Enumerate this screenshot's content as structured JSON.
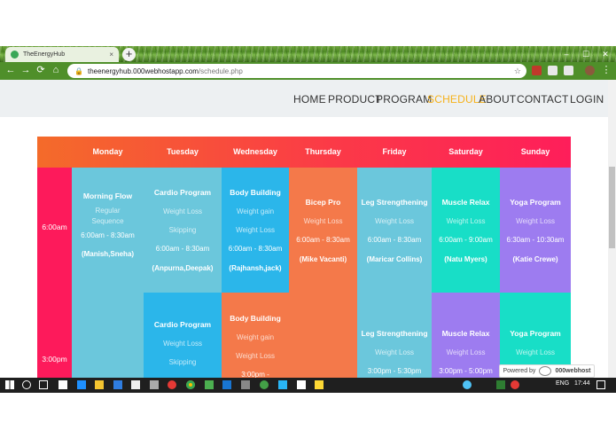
{
  "browser": {
    "tab_title": "TheEnergyHub",
    "tab_close": "×",
    "new_tab": "+",
    "url_host": "theenergyhub.000webhostapp.com",
    "url_path": "/schedule.php",
    "minimize": "–",
    "maximize": "☐",
    "close": "✕",
    "back": "←",
    "forward": "→",
    "reload": "⟳",
    "home": "⌂",
    "lock": "🔒",
    "star": "☆",
    "menu": "⋮"
  },
  "nav": {
    "home": "HOME",
    "product": "PRODUCT",
    "program": "PROGRAM",
    "schedule": "SCHEDULE",
    "about": "ABOUT",
    "contact": "CONTACT",
    "login": "LOGIN",
    "active_color": "#f6b21b"
  },
  "schedule": {
    "days": [
      "Monday",
      "Tuesday",
      "Wednesday",
      "Thursday",
      "Friday",
      "Saturday",
      "Sunday"
    ],
    "times": [
      "6:00am",
      "3:00pm"
    ],
    "morning": {
      "monday": {
        "title": "Morning Flow",
        "line1": "Regular",
        "line2": "Sequence",
        "time": "6:00am - 8:30am",
        "trainer": "(Manish,Sneha)"
      },
      "tuesday": {
        "title": "Cardio Program",
        "line1": "Weight Loss",
        "line2": "Skipping",
        "time": "6:00am - 8:30am",
        "trainer": "(Anpurna,Deepak)"
      },
      "wednesday": {
        "title": "Body Building",
        "line1": "Weight gain",
        "line2": "Weight Loss",
        "time": "6:00am - 8:30am",
        "trainer": "(Rajhansh,jack)"
      },
      "thursday": {
        "title": "Bicep Pro",
        "line1": "Weight Loss",
        "time": "6:00am - 8:30am",
        "trainer": "(Mike Vacanti)"
      },
      "friday": {
        "title": "Leg Strengthening",
        "line1": "Weight Loss",
        "time": "6:00am - 8:30am",
        "trainer": "(Maricar Collins)"
      },
      "saturday": {
        "title": "Muscle Relax",
        "line1": "Weight Loss",
        "time": "6:00am - 9:00am",
        "trainer": "(Natu Myers)"
      },
      "sunday": {
        "title": "Yoga Program",
        "line1": "Weight Loss",
        "time": "6:30am - 10:30am",
        "trainer": "(Katie Crewe)"
      }
    },
    "afternoon": {
      "tuesday": {
        "title": "Cardio Program",
        "line1": "Weight Loss",
        "line2": "Skipping"
      },
      "wednesday": {
        "title": "Body Building",
        "line1": "Weight gain",
        "line2": "Weight Loss",
        "time": "3:00pm -"
      },
      "friday": {
        "title": "Leg Strengthening",
        "line1": "Weight Loss",
        "time": "3:00pm - 5:30pm"
      },
      "saturday": {
        "title": "Muscle Relax",
        "line1": "Weight Loss",
        "time": "3:00pm - 5:00pm"
      },
      "sunday": {
        "title": "Yoga Program",
        "line1": "Weight Loss"
      }
    }
  },
  "badge": {
    "label": "Powered by",
    "brand": "000webhost"
  },
  "taskbar": {
    "lang": "ENG",
    "clock": "17:44"
  },
  "colors": {
    "header_start": "#f46b2a",
    "header_end": "#fe1e5a",
    "time_col": "#fd1a5b",
    "light_blue": "#6bc7dc",
    "sky_blue": "#2bb6ea",
    "orange": "#f4794a",
    "teal": "#18dec7",
    "purple": "#9d7cf0"
  }
}
